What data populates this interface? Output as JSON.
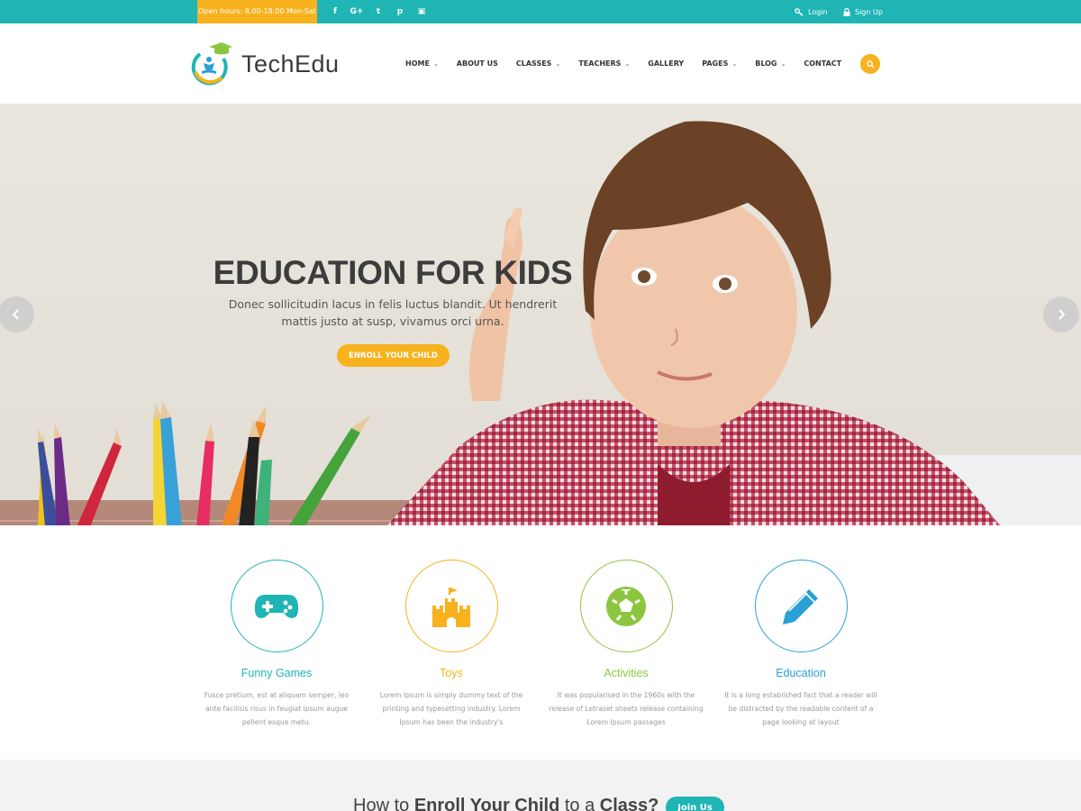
{
  "topbar": {
    "hours": "Open hours: 8.00-18.00 Mon-Sat",
    "socials": [
      {
        "icon": "facebook-icon",
        "glyph": "f"
      },
      {
        "icon": "google-plus-icon",
        "glyph": "G+"
      },
      {
        "icon": "twitter-icon",
        "glyph": "t"
      },
      {
        "icon": "pinterest-icon",
        "glyph": "p"
      },
      {
        "icon": "instagram-icon",
        "glyph": "▣"
      }
    ],
    "login": "Login",
    "signup": "Sign Up"
  },
  "header": {
    "logo_text": "TechEdu",
    "nav": [
      {
        "label": "HOME",
        "dropdown": true
      },
      {
        "label": "ABOUT US",
        "dropdown": false
      },
      {
        "label": "CLASSES",
        "dropdown": true
      },
      {
        "label": "TEACHERS",
        "dropdown": true
      },
      {
        "label": "GALLERY",
        "dropdown": false
      },
      {
        "label": "PAGES",
        "dropdown": true
      },
      {
        "label": "BLOG",
        "dropdown": true
      },
      {
        "label": "CONTACT",
        "dropdown": false
      }
    ],
    "search_icon": "search-icon"
  },
  "hero": {
    "title": "EDUCATION FOR KIDS",
    "subtitle": "Donec sollicitudin lacus in felis luctus blandit. Ut hendrerit mattis justo at susp, vivamus orci urna.",
    "cta": "ENROLL YOUR CHILD",
    "prev_icon": "chevron-left-icon",
    "next_icon": "chevron-right-icon"
  },
  "features": [
    {
      "title": "Funny Games",
      "color": "#1fb5b4",
      "icon": "gamepad-icon",
      "desc": "Fusce pretium, est at aliquam semper, leo ante facilisis risus in feugiat ipsum augue pellent esque metu."
    },
    {
      "title": "Toys",
      "color": "#f7b21d",
      "icon": "castle-icon",
      "desc": "Lorem Ipsum is simply dummy text of the printing and typesetting industry. Lorem Ipsum has been the industry's"
    },
    {
      "title": "Activities",
      "color": "#8cc63f",
      "icon": "soccer-ball-icon",
      "desc": "It was popularised in the 1960s with the release of Letraset sheets release containing Lorem Ipsum passages"
    },
    {
      "title": "Education",
      "color": "#2a9fd6",
      "icon": "pencil-icon",
      "desc": "It is a long established fact that a reader will be distracted by the readable content of a page looking at layout"
    }
  ],
  "enroll": {
    "text_1": "How to ",
    "text_bold_1": "Enroll Your Child",
    "text_2": " to a ",
    "text_bold_2": "Class?",
    "button": "Join Us"
  }
}
